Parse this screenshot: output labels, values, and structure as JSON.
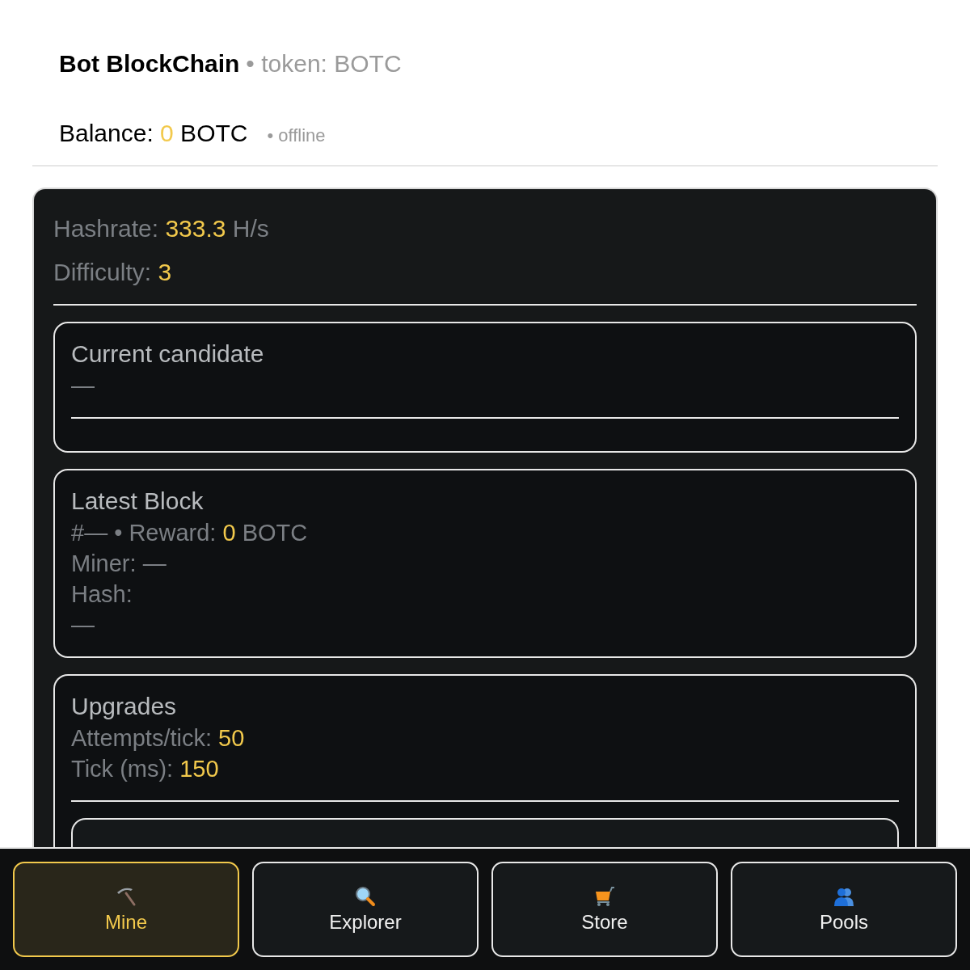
{
  "header": {
    "title": "Bot BlockChain",
    "subtitle": "• token: BOTC"
  },
  "balance": {
    "label": "Balance:",
    "value": "0",
    "unit": "BOTC",
    "status": "• offline"
  },
  "stats": [
    {
      "label": "Hashrate:",
      "value": "333.3",
      "unit": "H/s"
    },
    {
      "label": "Difficulty:",
      "value": "3"
    }
  ],
  "cards": [
    {
      "title": "Current candidate",
      "lines": [
        {
          "label": "—"
        }
      ],
      "divider": true
    },
    {
      "title": "Latest Block",
      "lines": [
        {
          "label": "#— • Reward:",
          "value": "0",
          "unit": "BOTC"
        },
        {
          "label": "Miner: —"
        },
        {
          "label": "Hash:"
        },
        {
          "label": "—"
        }
      ]
    },
    {
      "title": "Upgrades",
      "lines": [
        {
          "label": "Attempts/tick:",
          "value": "50"
        },
        {
          "label": "Tick (ms):",
          "value": "150"
        }
      ],
      "divider": true,
      "subcard": true
    }
  ],
  "nav": [
    {
      "label": "Mine",
      "selected": true
    },
    {
      "label": "Explorer",
      "selected": false
    },
    {
      "label": "Store",
      "selected": false
    },
    {
      "label": "Pools",
      "selected": false
    }
  ]
}
